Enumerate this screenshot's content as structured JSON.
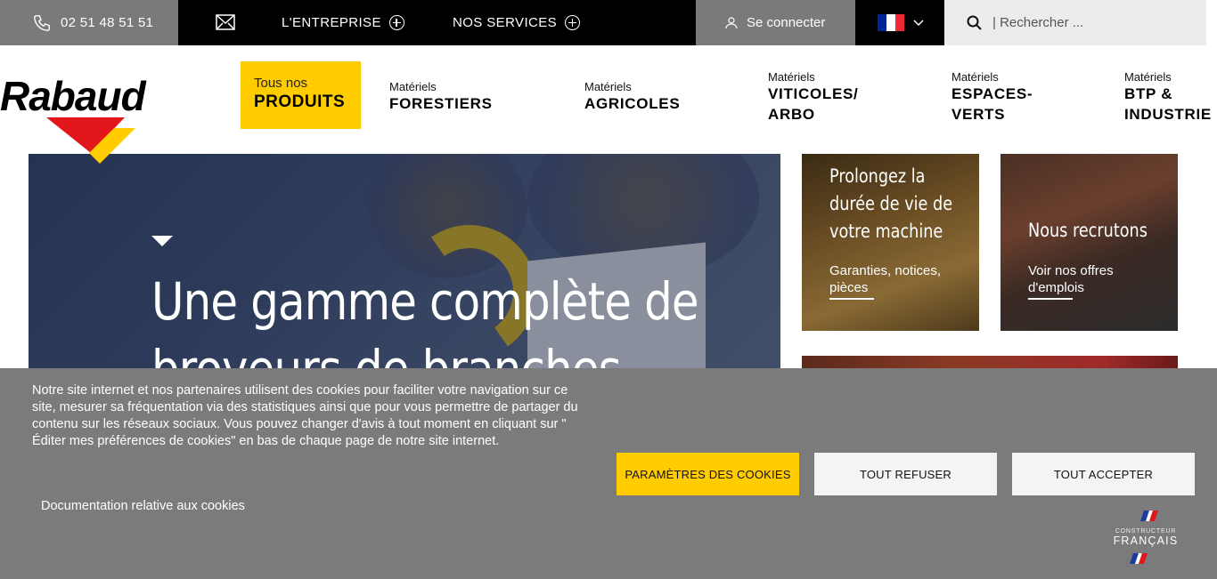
{
  "topbar": {
    "phone": "02 51 48 51 51",
    "nav": [
      {
        "label": "L'ENTREPRISE"
      },
      {
        "label": "NOS SERVICES"
      }
    ],
    "login_label": "Se connecter",
    "language_flag_colors": [
      "#002395",
      "#ffffff",
      "#ed2939"
    ],
    "search_placeholder": "| Rechercher ..."
  },
  "brand": {
    "logo_text": "Rabaud",
    "colors": {
      "yellow": "#ffcc00",
      "red": "#e3161b",
      "black": "#000000"
    }
  },
  "mainnav": {
    "products": {
      "small": "Tous nos",
      "big": "PRODUITS"
    },
    "items": [
      {
        "small": "Matériels",
        "big_line1": "FORESTIERS",
        "big_line2": ""
      },
      {
        "small": "Matériels",
        "big_line1": "AGRICOLES",
        "big_line2": ""
      },
      {
        "small": "Matériels",
        "big_line1": "VITICOLES/",
        "big_line2": "ARBO"
      },
      {
        "small": "Matériels",
        "big_line1": "ESPACES-",
        "big_line2": "VERTS"
      },
      {
        "small": "Matériels",
        "big_line1": "BTP &",
        "big_line2": "INDUSTRIE"
      }
    ]
  },
  "hero": {
    "title_line1": "Une gamme complète de",
    "title_line2": "broyeurs de branches"
  },
  "tiles": [
    {
      "title_lines": [
        "Prolongez la",
        "durée de vie de",
        "votre machine"
      ],
      "link_line1": "Garanties, notices,",
      "link_line2": "pièces"
    },
    {
      "title_lines": [
        "Nous recrutons"
      ],
      "link_line1": "Voir nos offres",
      "link_line2": "d'emplois"
    }
  ],
  "cookie": {
    "text": "Notre site internet et nos partenaires utilisent des cookies pour faciliter votre navigation sur ce site, mesurer sa fréquentation via des statistiques ainsi que pour vous permettre de partager du contenu sur les réseaux sociaux. Vous pouvez changer d'avis à tout moment en cliquant sur \" Éditer mes préférences de cookies\" en bas de chaque page de notre site internet.",
    "doc_link": "Documentation relative aux cookies",
    "buttons": {
      "settings": "PARAMÈTRES DES COOKIES",
      "refuse": "TOUT REFUSER",
      "accept": "TOUT ACCEPTER"
    },
    "badge": {
      "small": "CONSTRUCTEUR",
      "big": "FRANÇAIS"
    }
  }
}
